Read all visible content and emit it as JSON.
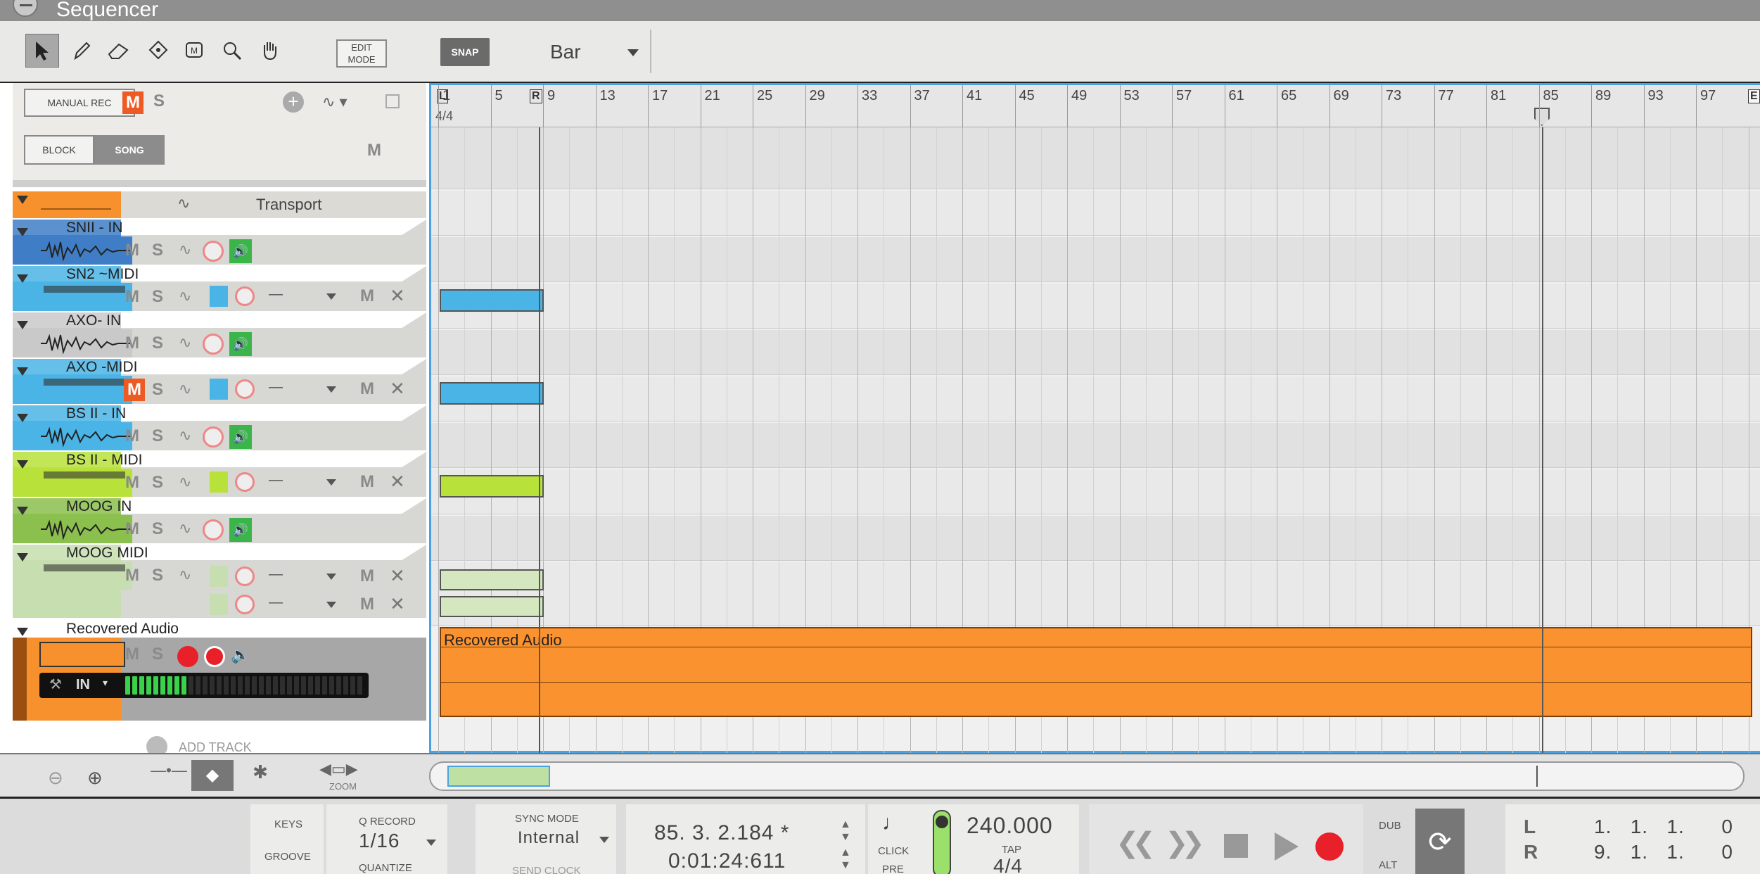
{
  "window": {
    "title": "Sequencer"
  },
  "toolbar": {
    "tools": [
      "arrow-tool",
      "pencil-tool",
      "eraser-tool",
      "razor-tool",
      "mute-tool",
      "magnify-tool",
      "hand-tool"
    ],
    "edit_mode_label": "EDIT\nMODE",
    "snap_label": "SNAP",
    "snap_value": "Bar"
  },
  "header": {
    "manual_rec": "MANUAL REC",
    "m": "M",
    "s": "S",
    "block": "BLOCK",
    "song": "SONG",
    "m2": "M"
  },
  "tracks": [
    {
      "name": "Transport",
      "color": "#f7912e"
    },
    {
      "name": "SNII - IN",
      "color": "#3f7ec6"
    },
    {
      "name": "SN2 ~MIDI",
      "color": "#4ab4e6"
    },
    {
      "name": "AXO- IN",
      "color": "#c9c9c9"
    },
    {
      "name": "AXO -MIDI",
      "color": "#4ab4e6"
    },
    {
      "name": "BS II - IN",
      "color": "#4ab4e6"
    },
    {
      "name": "BS II - MIDI",
      "color": "#b8e23a"
    },
    {
      "name": "MOOG IN",
      "color": "#8bbf4e"
    },
    {
      "name": "MOOG MIDI",
      "color": "#c7dfb0"
    },
    {
      "name": "Recovered Audio",
      "color": "#f7912e"
    }
  ],
  "track_labels": {
    "m": "M",
    "s": "S",
    "dash": "—",
    "in": "IN"
  },
  "add_track": "ADD TRACK",
  "ruler": {
    "bars": [
      "1",
      "5",
      "9",
      "13",
      "17",
      "21",
      "25",
      "29",
      "33",
      "37",
      "41",
      "45",
      "49",
      "53",
      "57",
      "61",
      "65",
      "69",
      "73",
      "77",
      "81",
      "85",
      "89",
      "93",
      "97"
    ],
    "sig": "4/4",
    "l": "L",
    "r": "R",
    "e": "E"
  },
  "clip_label": "Recovered Audio",
  "zoom": {
    "label": "ZOOM"
  },
  "transport": {
    "keys": "KEYS",
    "groove": "GROOVE",
    "q_record": "Q RECORD",
    "quantize_value": "1/16",
    "quantize": "QUANTIZE",
    "sync_mode": "SYNC MODE",
    "sync_value": "Internal",
    "send_clock": "SEND CLOCK",
    "position": "85.  3.  2.184 *",
    "time": "0:01:24:611",
    "click": "CLICK",
    "pre": "PRE",
    "tempo": "240.000",
    "tap": "TAP",
    "signature": "4/4",
    "dub": "DUB",
    "alt": "ALT",
    "l": "L",
    "r": "R",
    "l_pos": "1.   1.   1.      0",
    "r_pos": "9.   1.   1.      0"
  },
  "colors": {
    "selection": "#4aa3e0",
    "orange": "#f7912e",
    "record": "#e8202a",
    "mute_on": "#ee5a24",
    "active_green": "#3bb54a"
  }
}
